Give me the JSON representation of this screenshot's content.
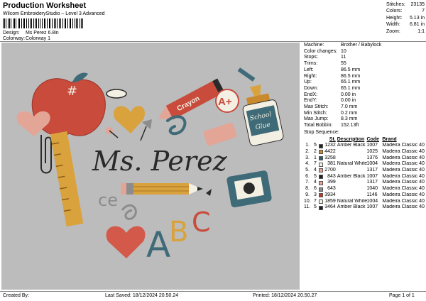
{
  "header": {
    "title": "Production Worksheet",
    "subtitle": "Wilcom EmbroideryStudio – Level 3 Advanced",
    "design_label": "Design:",
    "design_value": "Ms Perez 6.8in",
    "colorway_label": "Colorway:",
    "colorway_value": "Colorway 1"
  },
  "stats": [
    {
      "label": "Stitches:",
      "value": "23135"
    },
    {
      "label": "Colors:",
      "value": "7"
    },
    {
      "label": "Height:",
      "value": "5.13 in"
    },
    {
      "label": "Width:",
      "value": "6.81 in"
    },
    {
      "label": "Zoom:",
      "value": "1:1"
    }
  ],
  "info": [
    {
      "label": "Machine:",
      "value": "Brother / Babylock"
    },
    {
      "label": "Color changes:",
      "value": "10"
    },
    {
      "label": "Stops:",
      "value": "11"
    },
    {
      "label": "Trims:",
      "value": "55"
    },
    {
      "label": "Left:",
      "value": "86.5 mm"
    },
    {
      "label": "Right:",
      "value": "86.5 mm"
    },
    {
      "label": "Up:",
      "value": "65.1 mm"
    },
    {
      "label": "Down:",
      "value": "65.1 mm"
    },
    {
      "label": "EndX:",
      "value": "0.00 in"
    },
    {
      "label": "EndY:",
      "value": "0.00 in"
    },
    {
      "label": "Max Stitch:",
      "value": "7.0 mm"
    },
    {
      "label": "Min Stitch:",
      "value": "0.2 mm"
    },
    {
      "label": "Max Jump:",
      "value": "8.3 mm"
    },
    {
      "label": "Total Bobbin:",
      "value": "152.13ft"
    }
  ],
  "stop_sequence": {
    "title": "Stop Sequence:",
    "col_st": "St.",
    "col_desc": "Description",
    "col_code": "Code",
    "col_brand": "Brand",
    "rows": [
      {
        "n": "1.",
        "stop": "5",
        "color": "#222222",
        "st": "1232",
        "desc": "Amber Black",
        "code": "1007",
        "brand": "Madeira Classic 40"
      },
      {
        "n": "2.",
        "stop": "2",
        "color": "#c98a2e",
        "st": "4422",
        "desc": "",
        "code": "1025",
        "brand": "Madeira Classic 40"
      },
      {
        "n": "3.",
        "stop": "1",
        "color": "#2f5d6b",
        "st": "3258",
        "desc": "",
        "code": "1376",
        "brand": "Madeira Classic 40"
      },
      {
        "n": "4.",
        "stop": "7",
        "color": "#f4f1e6",
        "st": "381",
        "desc": "Natural White",
        "code": "1004",
        "brand": "Madeira Classic 40"
      },
      {
        "n": "5.",
        "stop": "4",
        "color": "#e8a593",
        "st": "2700",
        "desc": "",
        "code": "1317",
        "brand": "Madeira Classic 40"
      },
      {
        "n": "6.",
        "stop": "5",
        "color": "#222222",
        "st": "843",
        "desc": "Amber Black",
        "code": "1007",
        "brand": "Madeira Classic 40"
      },
      {
        "n": "7.",
        "stop": "4",
        "color": "#e8a593",
        "st": "399",
        "desc": "",
        "code": "1317",
        "brand": "Madeira Classic 40"
      },
      {
        "n": "8.",
        "stop": "6",
        "color": "#8c8c8c",
        "st": "643",
        "desc": "",
        "code": "1040",
        "brand": "Madeira Classic 40"
      },
      {
        "n": "9.",
        "stop": "3",
        "color": "#c0392b",
        "st": "3934",
        "desc": "",
        "code": "1146",
        "brand": "Madeira Classic 40"
      },
      {
        "n": "10.",
        "stop": "7",
        "color": "#f4f1e6",
        "st": "1859",
        "desc": "Natural White",
        "code": "1004",
        "brand": "Madeira Classic 40"
      },
      {
        "n": "11.",
        "stop": "5",
        "color": "#222222",
        "st": "3464",
        "desc": "Amber Black",
        "code": "1007",
        "brand": "Madeira Classic 40"
      }
    ]
  },
  "artwork": {
    "name_text": "Ms. Perez",
    "crayon_text": "Crayon",
    "grade_text": "A+",
    "glue_line1": "School",
    "glue_line2": "Glue",
    "abc_a": "A",
    "abc_b": "B",
    "abc_c": "C",
    "ce_text": "ce",
    "apple_mark": "#",
    "colors": {
      "background": "#bcbcbc",
      "apple_red": "#c84b3c",
      "mustard": "#d9a23c",
      "teal": "#3f6b78",
      "pink": "#e3a596",
      "coral": "#d35a4a",
      "dark": "#2a2a2a",
      "cream": "#f3efe2"
    }
  },
  "footer": {
    "created_by": "Created By:",
    "last_saved": "Last Saved: 18/12/2024 20.50.24",
    "printed": "Printed: 18/12/2024 20.50.27",
    "page": "Page 1 of 1"
  }
}
